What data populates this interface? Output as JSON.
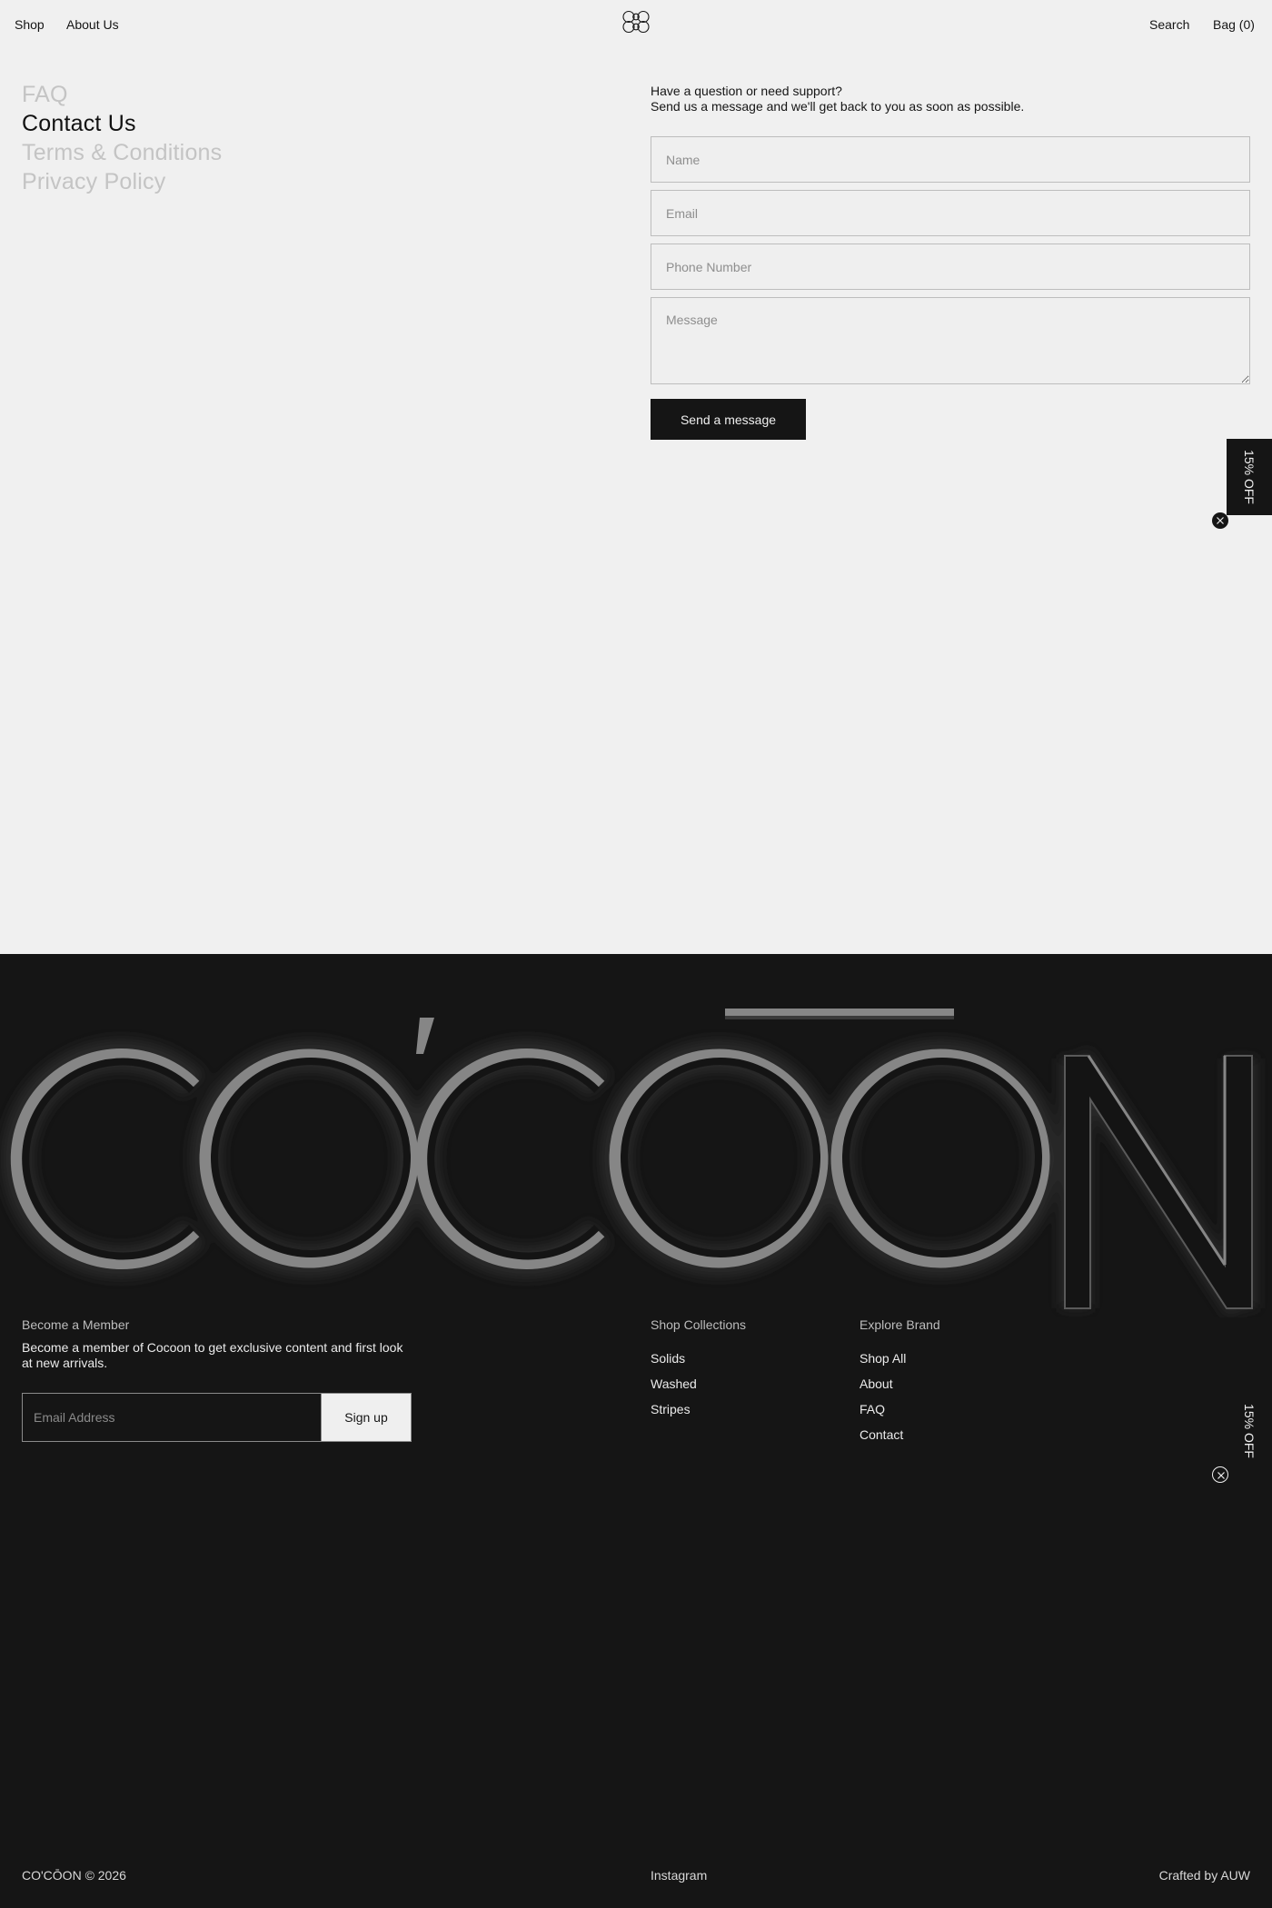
{
  "header": {
    "nav_left": [
      "Shop",
      "About Us"
    ],
    "search_label": "Search",
    "bag_label": "Bag (0)"
  },
  "side_menu": {
    "items": [
      {
        "label": "FAQ",
        "active": false
      },
      {
        "label": "Contact Us",
        "active": true
      },
      {
        "label": "Terms & Conditions",
        "active": false
      },
      {
        "label": "Privacy Policy",
        "active": false
      }
    ]
  },
  "contact": {
    "intro_line1": "Have a question or need support?",
    "intro_line2": "Send us a message and we'll get back to you as soon as possible.",
    "fields": {
      "name": {
        "placeholder": "Name",
        "value": ""
      },
      "email": {
        "placeholder": "Email",
        "value": ""
      },
      "phone": {
        "placeholder": "Phone Number",
        "value": ""
      },
      "message": {
        "placeholder": "Message",
        "value": ""
      }
    },
    "submit_label": "Send a message"
  },
  "promo": {
    "label": "15% OFF",
    "icons": [
      "close-icon"
    ]
  },
  "footer": {
    "wordmark": "CO'CŌON",
    "member": {
      "heading": "Become a Member",
      "text": "Become a member of Cocoon to get exclusive content and first look at new arrivals.",
      "email_placeholder": "Email Address",
      "signup_label": "Sign up"
    },
    "shop": {
      "heading": "Shop Collections",
      "links": [
        "Solids",
        "Washed",
        "Stripes"
      ]
    },
    "brand": {
      "heading": "Explore Brand",
      "links": [
        "Shop All",
        "About",
        "FAQ",
        "Contact"
      ]
    },
    "bottom": {
      "copyright": "CO'CŌON © 2026",
      "social": "Instagram",
      "credit": "Crafted by AUW"
    }
  },
  "colors": {
    "background": "#f0f0f0",
    "footer_bg": "#151515",
    "text_dark": "#151515",
    "inactive_menu": "#c4c4c4"
  }
}
